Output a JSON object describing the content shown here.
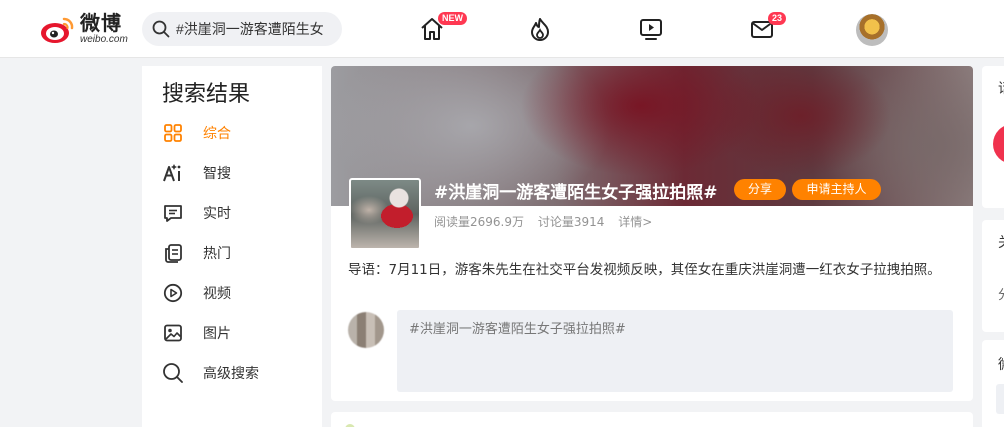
{
  "header": {
    "logo_cn": "微博",
    "logo_en": "weibo.com",
    "search_value": "#洪崖洞一游客遭陌生女",
    "nav": [
      {
        "name": "home-icon",
        "badge": "NEW"
      },
      {
        "name": "hot-icon",
        "badge": ""
      },
      {
        "name": "video-icon",
        "badge": ""
      },
      {
        "name": "mail-icon",
        "badge": "23"
      }
    ]
  },
  "sidebar": {
    "title": "搜索结果",
    "items": [
      {
        "label": "综合",
        "icon": "grid-icon",
        "active": true
      },
      {
        "label": "智搜",
        "icon": "ai-icon",
        "active": false
      },
      {
        "label": "实时",
        "icon": "realtime-icon",
        "active": false
      },
      {
        "label": "热门",
        "icon": "hot-list-icon",
        "active": false
      },
      {
        "label": "视频",
        "icon": "play-icon",
        "active": false
      },
      {
        "label": "图片",
        "icon": "image-icon",
        "active": false
      },
      {
        "label": "高级搜索",
        "icon": "search-icon",
        "active": false
      }
    ]
  },
  "topic": {
    "title": "#洪崖洞一游客遭陌生女子强拉拍照#",
    "share_label": "分享",
    "host_label": "申请主持人",
    "reads": "阅读量2696.9万",
    "discussions": "讨论量3914",
    "details": "详情>",
    "lead": "导语：7月11日，游客朱先生在社交平台发视频反映，其侄女在重庆洪崖洞遭一红衣女子拉拽拍照。",
    "compose_text": "#洪崖洞一游客遭陌生女子强拉拍照#"
  },
  "right": {
    "texts": [
      "话",
      "关",
      "分",
      "微"
    ]
  },
  "colors": {
    "accent": "#ff8200",
    "badge": "#ff3852"
  }
}
